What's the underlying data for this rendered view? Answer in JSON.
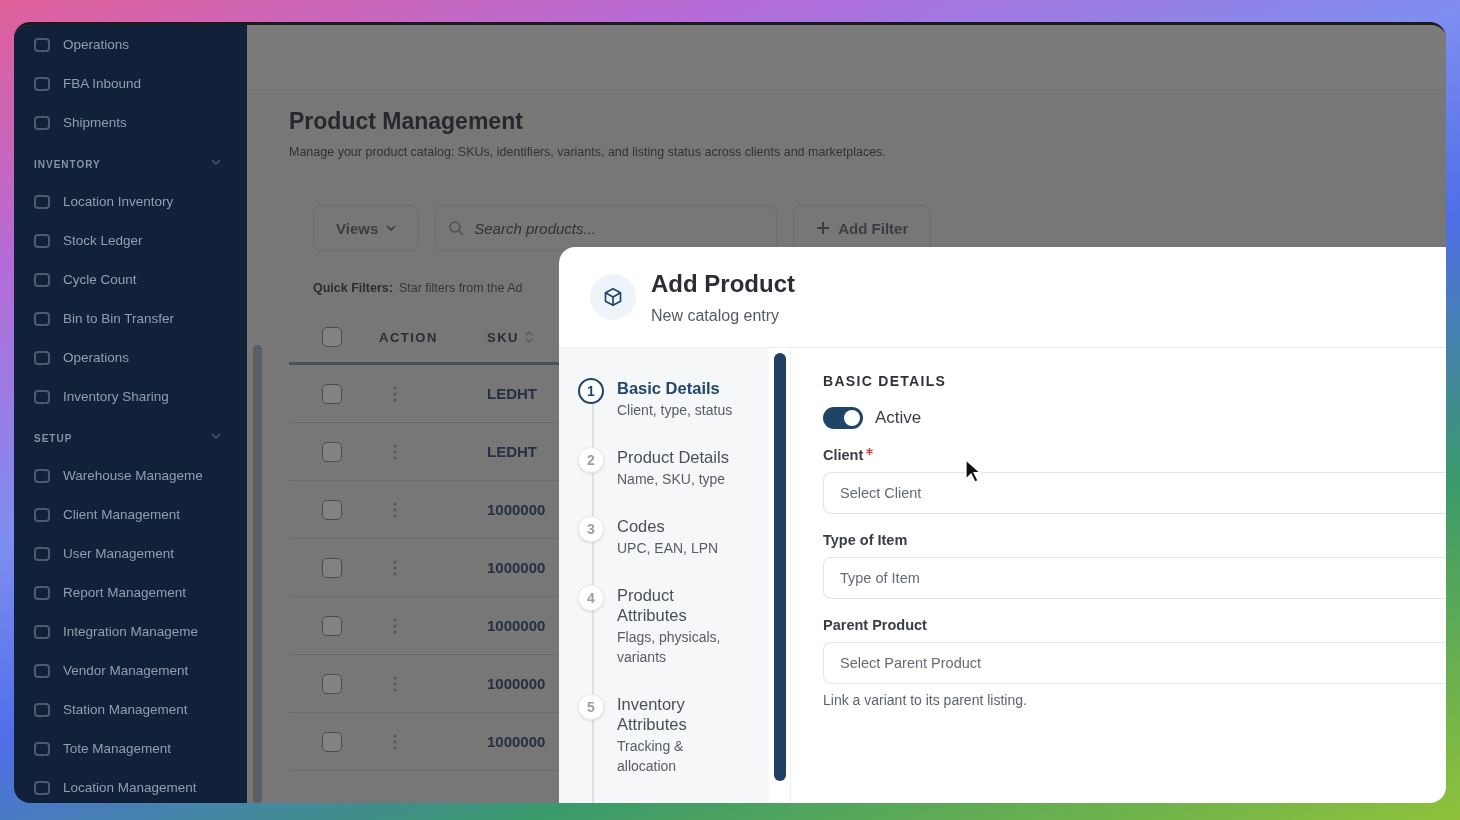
{
  "sidebar": {
    "sections": [
      {
        "items": [
          {
            "label": "Operations"
          },
          {
            "label": "FBA Inbound"
          },
          {
            "label": "Shipments"
          }
        ]
      },
      {
        "title": "INVENTORY",
        "expanded": true,
        "items": [
          {
            "label": "Location Inventory"
          },
          {
            "label": "Stock Ledger"
          },
          {
            "label": "Cycle Count"
          },
          {
            "label": "Bin to Bin Transfer"
          },
          {
            "label": "Operations"
          },
          {
            "label": "Inventory Sharing"
          }
        ]
      },
      {
        "title": "SETUP",
        "expanded": true,
        "items": [
          {
            "label": "Warehouse Manageme"
          },
          {
            "label": "Client Management"
          },
          {
            "label": "User Management"
          },
          {
            "label": "Report Management"
          },
          {
            "label": "Integration Manageme"
          },
          {
            "label": "Vendor Management"
          },
          {
            "label": "Station Management"
          },
          {
            "label": "Tote Management"
          },
          {
            "label": "Location Management"
          }
        ]
      }
    ]
  },
  "page": {
    "title": "Product Management",
    "subtitle": "Manage your product catalog: SKUs, identifiers, variants, and listing status across clients and marketplaces.",
    "toolbar": {
      "views": "Views",
      "search_placeholder": "Search products...",
      "add_filter": "Add Filter"
    },
    "quick_filters": {
      "label": "Quick Filters:",
      "text": "Star filters from the Ad"
    },
    "table": {
      "columns": [
        "ACTION",
        "SKU"
      ],
      "header_checked": false,
      "rows": [
        {
          "checked": false,
          "sku": "LEDHT"
        },
        {
          "checked": false,
          "sku": "LEDHT"
        },
        {
          "checked": false,
          "sku": "1000000"
        },
        {
          "checked": false,
          "sku": "1000000"
        },
        {
          "checked": false,
          "sku": "1000000"
        },
        {
          "checked": false,
          "sku": "1000000"
        },
        {
          "checked": false,
          "sku": "1000000"
        }
      ]
    }
  },
  "modal": {
    "title": "Add Product",
    "subtitle": "New catalog entry",
    "steps": [
      {
        "number": "1",
        "title": "Basic Details",
        "subtitle": "Client, type, status",
        "selected": true
      },
      {
        "number": "2",
        "title": "Product Details",
        "subtitle": "Name, SKU, type",
        "selected": false
      },
      {
        "number": "3",
        "title": "Codes",
        "subtitle": "UPC, EAN, LPN",
        "selected": false
      },
      {
        "number": "4",
        "title": "Product Attributes",
        "subtitle": "Flags, physicals, variants",
        "selected": false
      },
      {
        "number": "5",
        "title": "Inventory Attributes",
        "subtitle": "Tracking & allocation",
        "selected": false
      }
    ],
    "section_title": "BASIC DETAILS",
    "active_toggle": {
      "label": "Active",
      "on": true
    },
    "fields": [
      {
        "label": "Client",
        "required": true,
        "placeholder": "Select Client"
      },
      {
        "label": "Type of Item",
        "required": false,
        "placeholder": "Type of Item"
      },
      {
        "label": "Parent Product",
        "required": false,
        "placeholder": "Select Parent Product",
        "help": "Link a variant to its parent listing."
      }
    ]
  }
}
